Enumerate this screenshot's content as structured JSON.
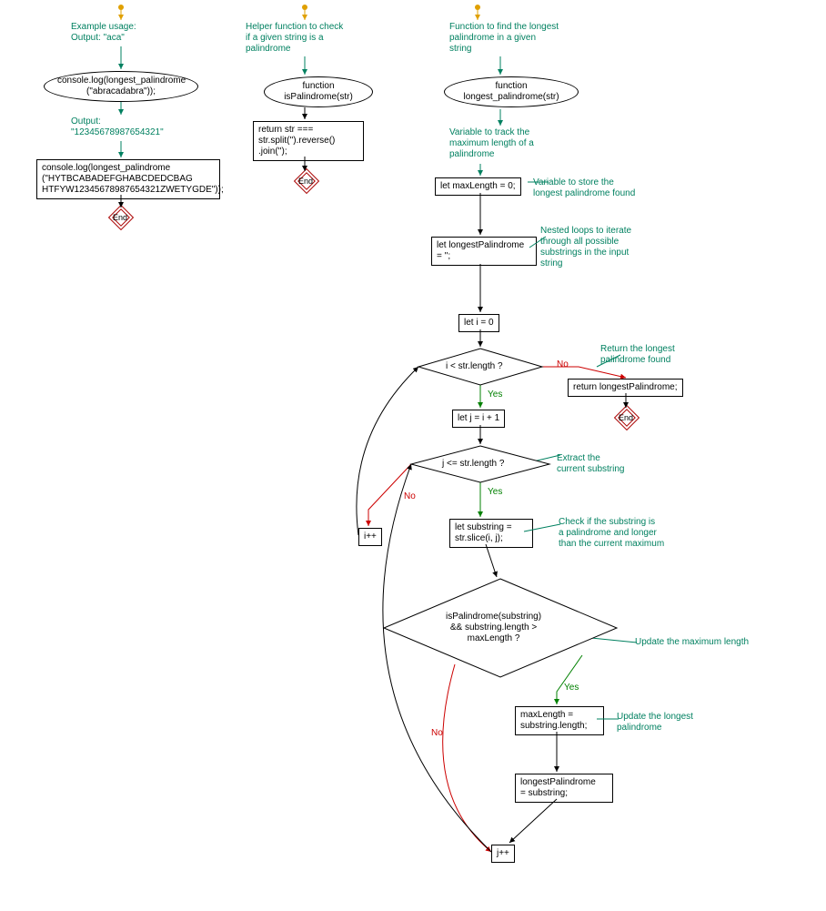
{
  "comments": {
    "example_usage": "Example usage:\nOutput: \"aca\"",
    "output2": "Output:\n\"12345678987654321\"",
    "helper_fn": "Helper function to check\nif a given string is a\npalindrome",
    "main_fn": "Function to find the longest\npalindrome in a given\nstring",
    "var_maxlen": "Variable to track the\nmaximum length of a\npalindrome",
    "var_longest": "Variable to store the\nlongest palindrome found",
    "nested_loops": "Nested loops to iterate\nthrough all possible\nsubstrings in the input\nstring",
    "return_longest": "Return the longest\npalindrome found",
    "extract_sub": "Extract the\ncurrent substring",
    "check_pal": "Check if the substring is\na palindrome and longer\nthan the current maximum",
    "update_maxlen": "Update the maximum length",
    "update_longest": "Update the longest\npalindrome"
  },
  "nodes": {
    "call1": "console.log(longest_palindrome\n(\"abracadabra\"));",
    "call2": "console.log(longest_palindrome\n(\"HYTBCABADEFGHABCDEDCBAG\nHTFYW12345678987654321ZWETYGDE\"));",
    "fn_ispal": "function\nisPalindrome(str)",
    "ret_ispal": "return str ===\nstr.split('').reverse()\n.join('');",
    "fn_longest": "function\nlongest_palindrome(str)",
    "let_maxlen": "let maxLength = 0;",
    "let_longest": "let longestPalindrome\n= '';",
    "let_i": "let i = 0",
    "cond_i": "i < str.length ?",
    "ret_longest": "return longestPalindrome;",
    "let_j": "let j = i + 1",
    "cond_j": "j <= str.length ?",
    "let_sub": "let substring =\nstr.slice(i, j);",
    "cond_pal": "isPalindrome(substring)\n&& substring.length >\nmaxLength ?",
    "set_maxlen": "maxLength =\nsubstring.length;",
    "set_longest": "longestPalindrome\n= substring;",
    "i_inc": "i++",
    "j_inc": "j++",
    "end": "End"
  },
  "labels": {
    "yes": "Yes",
    "no": "No"
  }
}
